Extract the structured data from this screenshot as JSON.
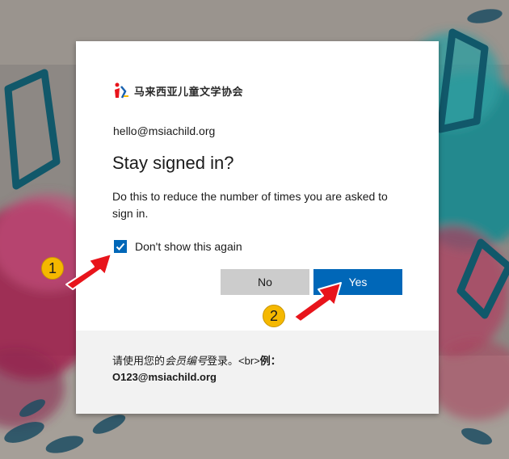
{
  "brand": {
    "logo_text": "马来西亚儿童文学协会"
  },
  "account": {
    "email": "hello@msiachild.org"
  },
  "dialog": {
    "title": "Stay signed in?",
    "description": "Do this to reduce the number of times you are asked to sign in.",
    "checkbox_label": "Don't show this again",
    "checkbox_checked": true,
    "no_label": "No",
    "yes_label": "Yes"
  },
  "footer": {
    "line1_a": "请使用您的",
    "line1_em": "会员编号",
    "line1_b": "登录。<br>",
    "line1_c": "例：",
    "line2": "O123@msiachild.org"
  },
  "annotations": {
    "step1": "1",
    "step2": "2"
  },
  "colors": {
    "accent": "#0067b8",
    "button_secondary": "#cccccc",
    "footer_bg": "#f2f2f2",
    "annotation_arrow": "#e8141b",
    "annotation_badge": "#f5b800"
  }
}
